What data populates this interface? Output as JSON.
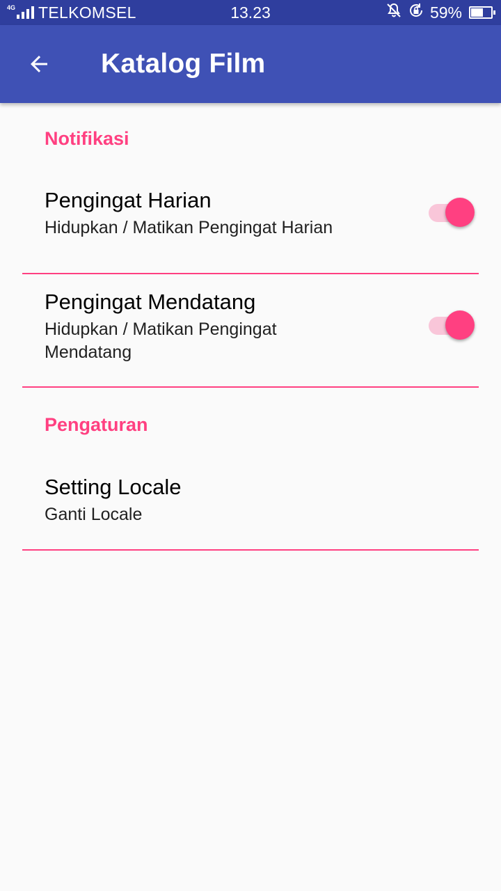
{
  "status_bar": {
    "network": "4G",
    "carrier": "TELKOMSEL",
    "time": "13.23",
    "battery_percent": "59%",
    "battery_level": 0.59,
    "icons": [
      "signal-icon",
      "bell-off-icon",
      "rotation-lock-icon",
      "battery-icon"
    ]
  },
  "app_bar": {
    "title": "Katalog Film",
    "back_icon": "arrow-left-icon",
    "background": "#3f51b5"
  },
  "sections": [
    {
      "header": "Notifikasi",
      "items": [
        {
          "title": "Pengingat Harian",
          "summary": "Hidupkan / Matikan Pengingat Harian",
          "switch_on": true
        },
        {
          "title": "Pengingat Mendatang",
          "summary": "Hidupkan / Matikan Pengingat Mendatang",
          "switch_on": true
        }
      ]
    },
    {
      "header": "Pengaturan",
      "items": [
        {
          "title": "Setting Locale",
          "summary": "Ganti Locale"
        }
      ]
    }
  ],
  "colors": {
    "accent": "#ff4081",
    "primary": "#3f51b5",
    "primary_dark": "#2f3e9e"
  }
}
